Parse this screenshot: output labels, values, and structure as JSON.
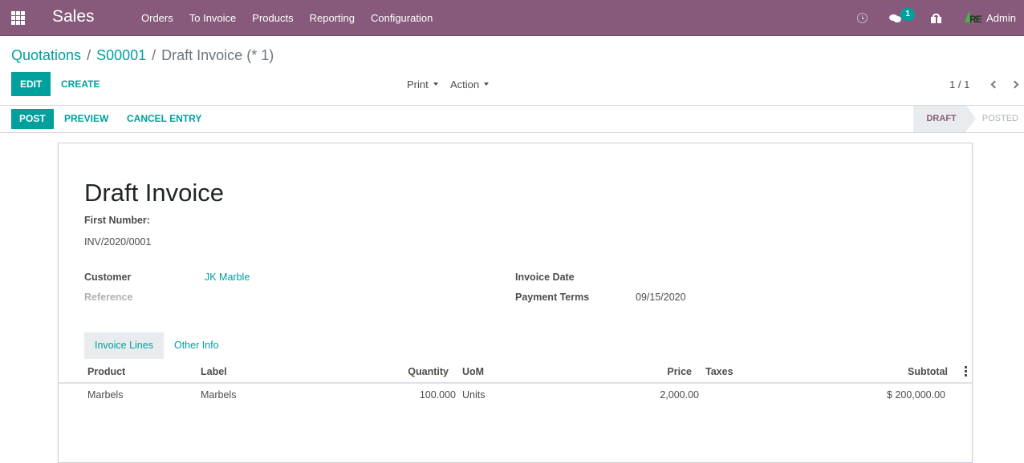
{
  "navbar": {
    "app_name": "Sales",
    "menu": [
      "Orders",
      "To Invoice",
      "Products",
      "Reporting",
      "Configuration"
    ],
    "icons": {
      "apps": "apps-grid-icon",
      "activity": "clock-icon",
      "messaging": "chat-icon",
      "gift": "gift-icon"
    },
    "message_count": "1",
    "user_name": "Admin",
    "avatar_text": "RE"
  },
  "breadcrumb": {
    "items": [
      "Quotations",
      "S00001"
    ],
    "separator": "/",
    "current": "Draft Invoice (* 1)"
  },
  "toolbar": {
    "edit_label": "EDIT",
    "create_label": "CREATE",
    "print_label": "Print",
    "action_label": "Action",
    "pager_value": "1 / 1"
  },
  "statusbar": {
    "post_label": "POST",
    "preview_label": "PREVIEW",
    "cancel_label": "CANCEL ENTRY",
    "steps": [
      "DRAFT",
      "POSTED"
    ],
    "active_step": "DRAFT"
  },
  "invoice": {
    "title": "Draft Invoice",
    "first_number_label": "First Number:",
    "first_number_value": "INV/2020/0001",
    "customer_label": "Customer",
    "customer_value": "JK Marble",
    "reference_label": "Reference",
    "invoice_date_label": "Invoice Date",
    "invoice_date_value": "",
    "payment_terms_label": "Payment Terms",
    "payment_terms_value": "09/15/2020"
  },
  "tabs": [
    "Invoice Lines",
    "Other Info"
  ],
  "active_tab": "Invoice Lines",
  "lines": {
    "columns": [
      "Product",
      "Label",
      "Quantity",
      "UoM",
      "Price",
      "Taxes",
      "Subtotal"
    ],
    "rows": [
      {
        "product": "Marbels",
        "label": "Marbels",
        "quantity": "100.000",
        "uom": "Units",
        "price": "2,000.00",
        "taxes": "",
        "subtotal": "$ 200,000.00"
      }
    ]
  },
  "colors": {
    "brand": "#875a7b",
    "accent": "#00a09d",
    "text": "#4c4c4c",
    "muted": "#adb5bd"
  }
}
